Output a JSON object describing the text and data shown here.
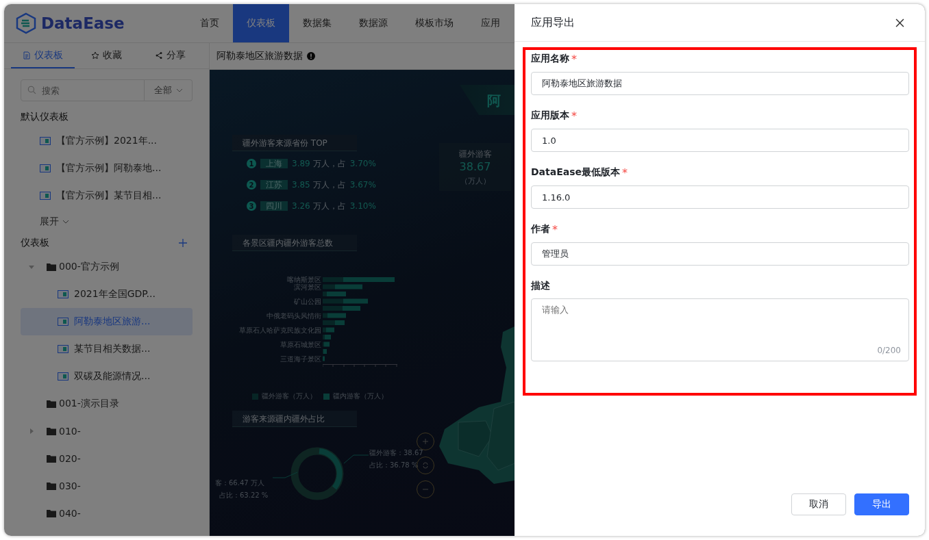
{
  "header": {
    "logo": "DataEase",
    "nav": [
      {
        "label": "首页",
        "selected": false
      },
      {
        "label": "仪表板",
        "selected": true
      },
      {
        "label": "数据集",
        "selected": false
      },
      {
        "label": "数据源",
        "selected": false
      },
      {
        "label": "模板市场",
        "selected": false
      },
      {
        "label": "应用",
        "selected": false
      }
    ]
  },
  "sidebar": {
    "tabs": [
      {
        "label": "仪表板",
        "selected": true
      },
      {
        "label": "收藏",
        "selected": false
      },
      {
        "label": "分享",
        "selected": false
      }
    ],
    "search": {
      "placeholder": "搜索",
      "filter": "全部"
    },
    "default_title": "默认仪表板",
    "default_items": [
      "【官方示例】2021年...",
      "【官方示例】阿勒泰地...",
      "【官方示例】某节目相..."
    ],
    "expand_link": "展开",
    "tree_title": "仪表板",
    "tree": [
      {
        "kind": "folder",
        "label": "000-官方示例",
        "expanded": true,
        "selected": false,
        "children": [
          {
            "kind": "dashboard",
            "label": "2021年全国GDP...",
            "selected": false
          },
          {
            "kind": "dashboard",
            "label": "阿勒泰地区旅游...",
            "selected": true
          },
          {
            "kind": "dashboard",
            "label": "某节目相关数据...",
            "selected": false
          },
          {
            "kind": "dashboard",
            "label": "双碳及能源情况...",
            "selected": false
          }
        ]
      },
      {
        "kind": "folder",
        "label": "001-演示目录",
        "selected": false
      },
      {
        "kind": "folder",
        "label": "010-",
        "expanded": false,
        "selected": false
      },
      {
        "kind": "folder",
        "label": "020-",
        "selected": false
      },
      {
        "kind": "folder",
        "label": "030-",
        "selected": false
      },
      {
        "kind": "folder",
        "label": "040-",
        "selected": false
      }
    ]
  },
  "dashboard": {
    "title": "阿勒泰地区旅游数据",
    "banner": "阿",
    "top_panel": {
      "title": "疆外游客来源省份 TOP",
      "rows": [
        {
          "rank": "1",
          "province": "上海",
          "amount": "3.89",
          "unit": "万人，占",
          "share": "3.70%"
        },
        {
          "rank": "2",
          "province": "江苏",
          "amount": "3.85",
          "unit": "万人，占",
          "share": "3.67%"
        },
        {
          "rank": "3",
          "province": "四川",
          "amount": "3.26",
          "unit": "万人，占",
          "share": "3.10%"
        }
      ]
    },
    "stat_card": {
      "label": "疆外游客",
      "value": "38.67",
      "unit": "（万人）"
    },
    "bar_panel": {
      "title": "各景区疆内疆外游客总数",
      "labels": [
        "喀纳斯景区",
        "滨河景区",
        "矿山公园",
        "中俄老码头风情街",
        "草原石人哈萨克民族文化园",
        "草原石城景区",
        "三道海子景区"
      ],
      "legend": [
        "疆外游客（万人）",
        "疆内游客（万人）"
      ]
    },
    "donut_panel": {
      "title": "游客来源疆内疆外占比",
      "right_labels": [
        "疆外游客：38.67",
        "占比：36.78 %"
      ],
      "left_labels": [
        "客：66.47 万人",
        "占比：63.22 %"
      ]
    }
  },
  "dialog": {
    "title": "应用导出",
    "required_mark": "*",
    "fields": [
      {
        "kind": "input",
        "label": "应用名称",
        "required": true,
        "value": "阿勒泰地区旅游数据"
      },
      {
        "kind": "input",
        "label": "应用版本",
        "required": true,
        "value": "1.0"
      },
      {
        "kind": "input",
        "label": "DataEase最低版本",
        "required": true,
        "value": "1.16.0"
      },
      {
        "kind": "input",
        "label": "作者",
        "required": true,
        "value": "管理员"
      },
      {
        "kind": "textarea",
        "label": "描述",
        "placeholder": "请输入",
        "counter": "0/200"
      }
    ],
    "buttons": [
      {
        "label": "取消",
        "kind": "secondary"
      },
      {
        "label": "导出",
        "kind": "primary"
      }
    ]
  }
}
